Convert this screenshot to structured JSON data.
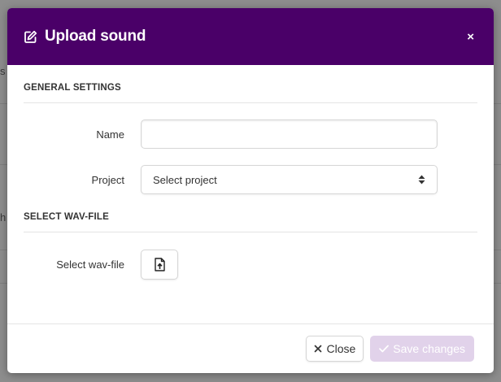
{
  "background": {
    "glyph_top": "s",
    "glyph_mid": "h"
  },
  "modal": {
    "title": "Upload sound",
    "header_icon": "edit-icon",
    "close_symbol": "×",
    "header_color": "#4a0068"
  },
  "sections": {
    "general": {
      "title": "GENERAL SETTINGS"
    },
    "wav": {
      "title": "SELECT WAV-FILE"
    }
  },
  "fields": {
    "name": {
      "label": "Name",
      "value": "",
      "placeholder": ""
    },
    "project": {
      "label": "Project",
      "selected": "Select project"
    },
    "wav_file": {
      "label": "Select wav-file",
      "icon": "file-upload-icon"
    }
  },
  "footer": {
    "close_label": "Close",
    "save_label": "Save changes",
    "save_color": "#e1d2ea"
  }
}
